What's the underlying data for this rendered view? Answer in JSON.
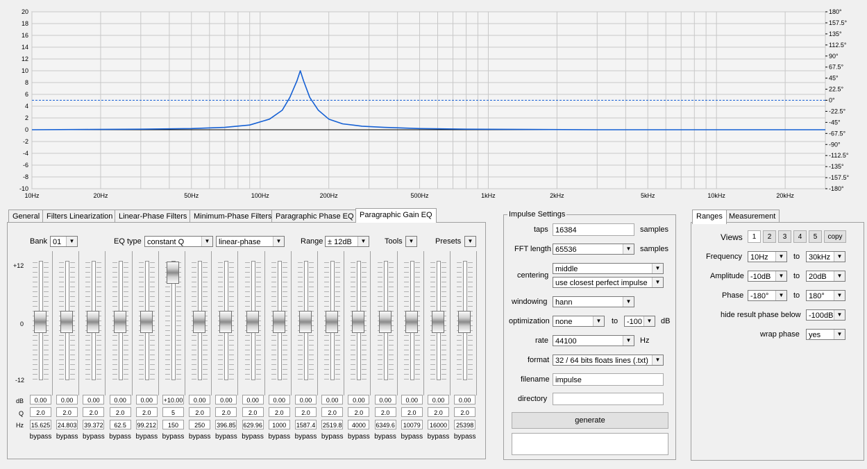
{
  "chart_data": {
    "type": "line",
    "x_axis": {
      "scale": "log",
      "range": [
        10,
        30000
      ],
      "tick_labels": [
        "10Hz",
        "20Hz",
        "50Hz",
        "100Hz",
        "200Hz",
        "500Hz",
        "1kHz",
        "2kHz",
        "5kHz",
        "10kHz",
        "20kHz"
      ],
      "tick_values": [
        10,
        20,
        50,
        100,
        200,
        500,
        1000,
        2000,
        5000,
        10000,
        20000
      ]
    },
    "y_left": {
      "range": [
        -10,
        20
      ],
      "tick_labels": [
        "20",
        "18",
        "16",
        "14",
        "12",
        "10",
        "8",
        "6",
        "4",
        "2",
        "0",
        "-2",
        "-4",
        "-6",
        "-8",
        "-10"
      ]
    },
    "y_right": {
      "range": [
        -180,
        180
      ],
      "tick_labels": [
        "180°",
        "157.5°",
        "135°",
        "112.5°",
        "90°",
        "67.5°",
        "45°",
        "22.5°",
        "0°",
        "-22.5°",
        "-45°",
        "-67.5°",
        "-90°",
        "-112.5°",
        "-135°",
        "-157.5°",
        "-180°"
      ]
    },
    "series": [
      {
        "kind": "gain_db",
        "x": [
          10,
          18,
          30,
          50,
          70,
          90,
          110,
          125,
          135,
          145,
          150,
          155,
          165,
          180,
          200,
          230,
          280,
          350,
          500,
          800,
          1500,
          3000,
          10000,
          30000
        ],
        "y": [
          0,
          0.05,
          0.1,
          0.2,
          0.4,
          0.8,
          1.8,
          3.3,
          5.5,
          8.3,
          10,
          8.3,
          5.5,
          3.3,
          1.8,
          1.0,
          0.6,
          0.4,
          0.2,
          0.1,
          0.05,
          0,
          0,
          0
        ]
      },
      {
        "kind": "phase_reference_degrees",
        "x": [
          10,
          30000
        ],
        "y": [
          0,
          0
        ]
      }
    ],
    "colors": {
      "gain_line": "#1560d4",
      "zero_line": "#000000",
      "grid": "#c8c8c8",
      "background": "#f4f4f4"
    },
    "grid": true
  },
  "tabs": [
    "General",
    "Filters Linearization",
    "Linear-Phase Filters",
    "Minimum-Phase Filters",
    "Paragraphic Phase EQ",
    "Paragraphic Gain EQ"
  ],
  "active_tab": "Paragraphic Gain EQ",
  "eq": {
    "bank_label": "Bank",
    "bank_value": "01",
    "eqtype_label": "EQ type",
    "eqtype_value": "constant Q",
    "phase_value": "linear-phase",
    "range_label": "Range",
    "range_value": "± 12dB",
    "tools_label": "Tools",
    "presets_label": "Presets",
    "scale_top": "+12",
    "scale_mid": "0",
    "scale_bottom": "-12",
    "row_db": "dB",
    "row_q": "Q",
    "row_hz": "Hz",
    "bypass_label": "bypass",
    "bands": [
      {
        "db": "0.00",
        "q": "2.0",
        "hz": "15.625",
        "level": 0
      },
      {
        "db": "0.00",
        "q": "2.0",
        "hz": "24.803",
        "level": 0
      },
      {
        "db": "0.00",
        "q": "2.0",
        "hz": "39.372",
        "level": 0
      },
      {
        "db": "0.00",
        "q": "2.0",
        "hz": "62.5",
        "level": 0
      },
      {
        "db": "0.00",
        "q": "2.0",
        "hz": "99.212",
        "level": 0
      },
      {
        "db": "+10.00",
        "q": "5",
        "hz": "150",
        "level": 10
      },
      {
        "db": "0.00",
        "q": "2.0",
        "hz": "250",
        "level": 0
      },
      {
        "db": "0.00",
        "q": "2.0",
        "hz": "396.85",
        "level": 0
      },
      {
        "db": "0.00",
        "q": "2.0",
        "hz": "629.96",
        "level": 0
      },
      {
        "db": "0.00",
        "q": "2.0",
        "hz": "1000",
        "level": 0
      },
      {
        "db": "0.00",
        "q": "2.0",
        "hz": "1587.4",
        "level": 0
      },
      {
        "db": "0.00",
        "q": "2.0",
        "hz": "2519.8",
        "level": 0
      },
      {
        "db": "0.00",
        "q": "2.0",
        "hz": "4000",
        "level": 0
      },
      {
        "db": "0.00",
        "q": "2.0",
        "hz": "6349.6",
        "level": 0
      },
      {
        "db": "0.00",
        "q": "2.0",
        "hz": "10079",
        "level": 0
      },
      {
        "db": "0.00",
        "q": "2.0",
        "hz": "16000",
        "level": 0
      },
      {
        "db": "0.00",
        "q": "2.0",
        "hz": "25398",
        "level": 0
      }
    ]
  },
  "impulse": {
    "title": "Impulse Settings",
    "taps_label": "taps",
    "taps_value": "16384",
    "taps_unit": "samples",
    "fft_label": "FFT length",
    "fft_value": "65536",
    "fft_unit": "samples",
    "centering_label": "centering",
    "centering_value": "middle",
    "centering_value2": "use closest perfect impulse",
    "windowing_label": "windowing",
    "windowing_value": "hann",
    "optimization_label": "optimization",
    "optimization_value": "none",
    "optimization_to": "to",
    "optimization_db_value": "-100",
    "optimization_db_unit": "dB",
    "rate_label": "rate",
    "rate_value": "44100",
    "rate_unit": "Hz",
    "format_label": "format",
    "format_value": "32 / 64 bits floats lines (.txt)",
    "filename_label": "filename",
    "filename_value": "impulse",
    "directory_label": "directory",
    "directory_value": "",
    "generate_label": "generate"
  },
  "ranges": {
    "tabs": [
      "Ranges",
      "Measurement"
    ],
    "views_label": "Views",
    "views": [
      "1",
      "2",
      "3",
      "4",
      "5"
    ],
    "copy_label": "copy",
    "frequency_label": "Frequency",
    "frequency_from": "10Hz",
    "frequency_to": "30kHz",
    "amplitude_label": "Amplitude",
    "amplitude_from": "-10dB",
    "amplitude_to": "20dB",
    "phase_label": "Phase",
    "phase_from": "-180°",
    "phase_to": "180°",
    "to_label": "to",
    "hide_label": "hide result phase below",
    "hide_value": "-100dB",
    "wrap_label": "wrap phase",
    "wrap_value": "yes"
  }
}
